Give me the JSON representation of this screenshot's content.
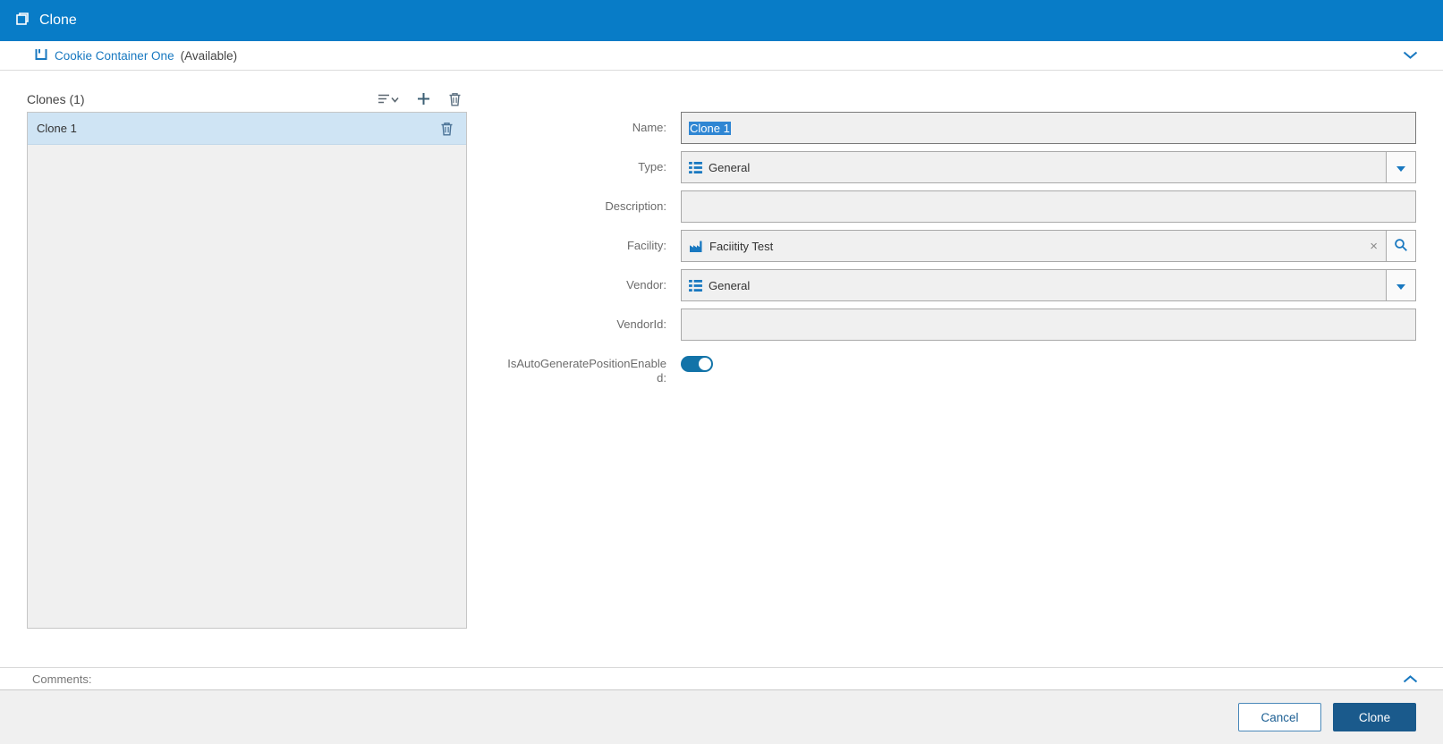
{
  "titlebar": {
    "title": "Clone"
  },
  "context_bar": {
    "name": "Cookie Container One",
    "status": "(Available)"
  },
  "clones_panel": {
    "header_label": "Clones (1)",
    "count": 1,
    "items": [
      {
        "label": "Clone 1",
        "selected": true
      }
    ]
  },
  "form": {
    "name": {
      "label": "Name:",
      "value": "Clone 1",
      "text_selected": true
    },
    "type": {
      "label": "Type:",
      "value": "General"
    },
    "description": {
      "label": "Description:",
      "value": ""
    },
    "facility": {
      "label": "Facility:",
      "value": "Faciitity Test"
    },
    "vendor": {
      "label": "Vendor:",
      "value": "General"
    },
    "vendor_id": {
      "label": "VendorId:",
      "value": ""
    },
    "auto_generate_position": {
      "label": "IsAutoGeneratePositionEnabled:",
      "state": "on"
    }
  },
  "comments": {
    "label": "Comments:"
  },
  "footer": {
    "cancel_label": "Cancel",
    "clone_label": "Clone"
  },
  "icons": {
    "clone_icon": "overlapping-squares",
    "container_icon": "open-container",
    "chevron_down_icon": "v-chevron",
    "chevron_up_icon": "^-chevron",
    "sort_icon": "sort-lines-with-caret",
    "add_icon": "+",
    "delete_icon": "trash-can",
    "list_icon": "detail-list-grid",
    "factory_icon": "factory",
    "clear_icon": "x",
    "search_icon": "magnifier",
    "dropdown_caret_icon": "solid-down-triangle"
  },
  "colors": {
    "titlebar_bg": "#087cc7",
    "accent_blue": "#1878c0",
    "selected_row_bg": "#cfe4f4",
    "text_selection_bg": "#2f86d3",
    "toggle_on_bg": "#1273a8",
    "primary_button_bg": "#1a5a8c",
    "field_bg": "#f0f0f0",
    "footer_bg": "#f0f0f0"
  }
}
